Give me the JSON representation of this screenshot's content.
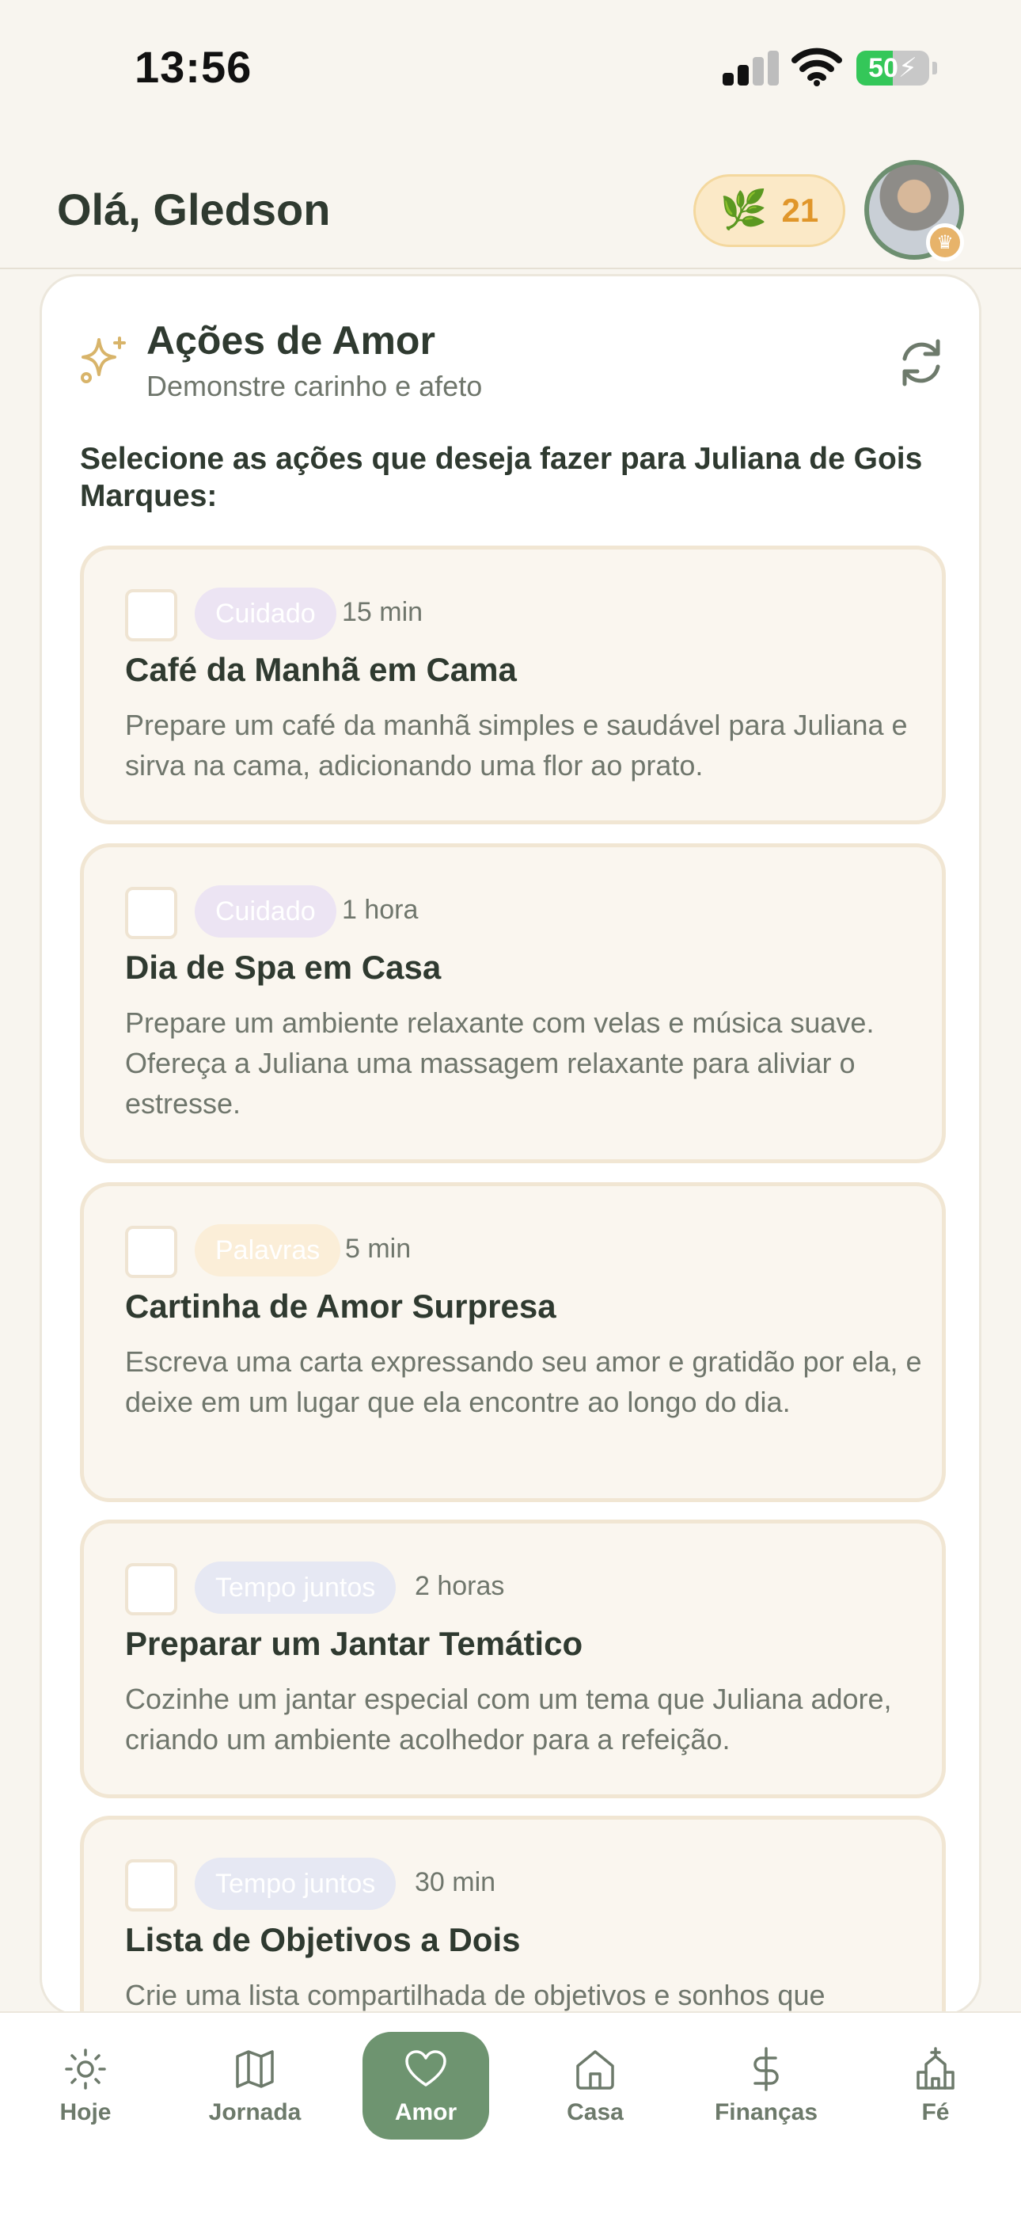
{
  "status_bar": {
    "time": "13:56",
    "battery": "50",
    "battery_level": 0.5
  },
  "header": {
    "greeting": "Olá, Gledson",
    "points": "21"
  },
  "section": {
    "title": "Ações de Amor",
    "subtitle": "Demonstre carinho e afeto",
    "prompt": "Selecione as ações que deseja fazer para Juliana de Gois Marques:"
  },
  "actions": [
    {
      "tag": "Cuidado",
      "duration": "15 min",
      "title": "Café da Manhã em Cama",
      "description": "Prepare um café da manhã simples e saudável para Juliana e sirva na cama, adicionando uma flor ao prato.",
      "checked": false
    },
    {
      "tag": "Cuidado",
      "duration": "1 hora",
      "title": "Dia de Spa em Casa",
      "description": "Prepare um ambiente relaxante com velas e música suave. Ofereça a Juliana uma massagem relaxante para aliviar o estresse.",
      "checked": false
    },
    {
      "tag": "Palavras",
      "duration": "5 min",
      "title": "Cartinha de Amor Surpresa",
      "description": "Escreva uma carta expressando seu amor e gratidão por ela, e deixe em um lugar que ela encontre ao longo do dia.",
      "checked": false
    },
    {
      "tag": "Tempo juntos",
      "duration": "2 horas",
      "title": "Preparar um Jantar Temático",
      "description": "Cozinhe um jantar especial com um tema que Juliana adore, criando um ambiente acolhedor para a refeição.",
      "checked": false
    },
    {
      "tag": "Tempo juntos",
      "duration": "30 min",
      "title": "Lista de Objetivos a Dois",
      "description": "Crie uma lista compartilhada de objetivos e sonhos que",
      "checked": false
    }
  ],
  "nav": [
    {
      "label": "Hoje",
      "icon": "sun-icon",
      "active": false
    },
    {
      "label": "Jornada",
      "icon": "map-icon",
      "active": false
    },
    {
      "label": "Amor",
      "icon": "heart-icon",
      "active": true
    },
    {
      "label": "Casa",
      "icon": "house-icon",
      "active": false
    },
    {
      "label": "Finanças",
      "icon": "dollar-icon",
      "active": false
    },
    {
      "label": "Fé",
      "icon": "church-icon",
      "active": false
    }
  ],
  "colors": {
    "background": "#f8f5ef",
    "accent_green": "#6e9470",
    "points_orange": "#e0962a",
    "tag_cuidado": "#ece4f3",
    "tag_palavras": "#fbeed8",
    "tag_tempo": "#e6e8f3"
  }
}
